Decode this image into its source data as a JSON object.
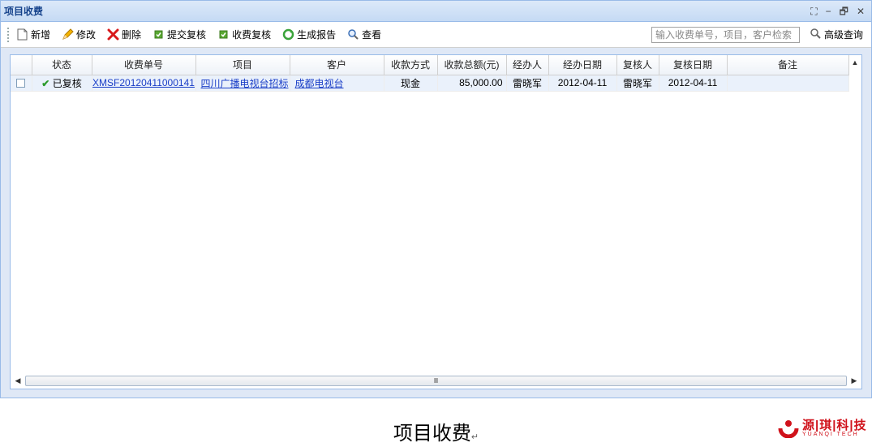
{
  "window": {
    "title": "项目收费",
    "tools": [
      "⛶",
      "−",
      "🗗",
      "✕"
    ]
  },
  "toolbar": {
    "buttons": [
      {
        "label": "新增",
        "icon": "new-doc-icon"
      },
      {
        "label": "修改",
        "icon": "pencil-icon"
      },
      {
        "label": "删除",
        "icon": "delete-x-icon"
      },
      {
        "label": "提交复核",
        "icon": "submit-check-icon"
      },
      {
        "label": "收费复核",
        "icon": "review-check-icon"
      },
      {
        "label": "生成报告",
        "icon": "refresh-report-icon"
      },
      {
        "label": "查看",
        "icon": "view-magnifier-icon"
      }
    ],
    "search_placeholder": "输入收费单号，项目，客户检索",
    "advanced_label": "高级查询"
  },
  "grid": {
    "columns": [
      "状态",
      "收费单号",
      "项目",
      "客户",
      "收款方式",
      "收款总额(元)",
      "经办人",
      "经办日期",
      "复核人",
      "复核日期",
      "备注"
    ],
    "rows": [
      {
        "status": "已复核",
        "fee_no": "XMSF20120411000141",
        "project": "四川广播电视台招标",
        "customer": "成都电视台",
        "payment_method": "现金",
        "amount": "85,000.00",
        "handler": "雷晓军",
        "handle_date": "2012-04-11",
        "reviewer": "雷晓军",
        "review_date": "2012-04-11",
        "remark": ""
      }
    ],
    "hscroll_thumb": "Ⅲ"
  },
  "caption": {
    "text": "项目收费",
    "mark": "↵"
  },
  "logo": {
    "brand": "源|琪|科|技",
    "sub": "YUANQI TECH"
  },
  "colors": {
    "accent": "#15428b",
    "link": "#1a3ec7",
    "brand": "#d0121b",
    "border": "#99bbe8"
  }
}
